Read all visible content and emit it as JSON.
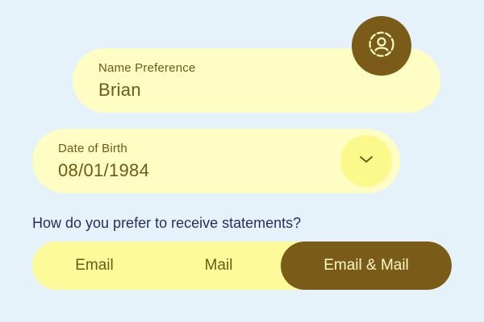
{
  "name_field": {
    "label": "Name Preference",
    "value": "Brian",
    "avatar_icon": "user-circle-icon"
  },
  "dob_field": {
    "label": "Date of Birth",
    "value": "08/01/1984",
    "dropdown_icon": "chevron-down-icon"
  },
  "statement_question": "How do you prefer to receive statements?",
  "statement_options": [
    {
      "label": "Email",
      "selected": false
    },
    {
      "label": "Mail",
      "selected": false
    },
    {
      "label": "Email & Mail",
      "selected": true
    }
  ],
  "colors": {
    "background": "#e6f2fa",
    "field_fill": "#fdfdc4",
    "accent_dark": "#7a5c18",
    "accent_light": "#fbf88c",
    "question_text": "#2c2a63"
  }
}
